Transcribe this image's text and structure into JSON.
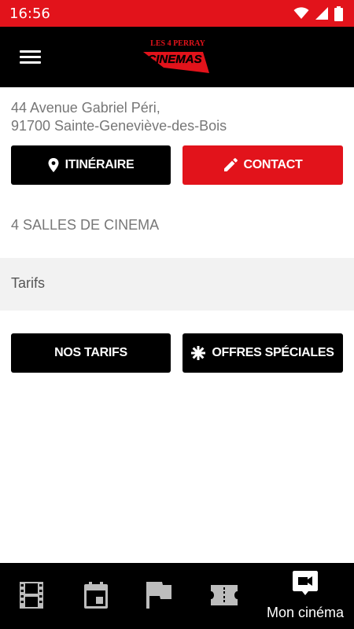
{
  "status_bar": {
    "time": "16:56",
    "icons": [
      "wifi-icon",
      "signal-icon",
      "battery-icon"
    ]
  },
  "app_bar": {
    "logo_top": "LES 4 PERRAY",
    "logo_main": "CINEMAS",
    "menu_icon": "hamburger-menu-icon"
  },
  "address": {
    "line1": "44 Avenue Gabriel Péri,",
    "line2": "91700 Sainte-Geneviève-des-Bois"
  },
  "actions": {
    "itinerary_label": "ITINÉRAIRE",
    "itinerary_icon": "location-pin-icon",
    "contact_label": "CONTACT",
    "contact_icon": "pencil-icon"
  },
  "salles_text": "4 SALLES DE CINEMA",
  "tarifs": {
    "title": "Tarifs",
    "nos_tarifs_label": "NOS TARIFS",
    "offres_label": "OFFRES SPÉCIALES",
    "offres_icon": "asterisk-icon"
  },
  "bottom_nav": {
    "items": [
      {
        "icon": "film-strip-icon",
        "label": ""
      },
      {
        "icon": "calendar-icon",
        "label": ""
      },
      {
        "icon": "flag-icon",
        "label": ""
      },
      {
        "icon": "ticket-icon",
        "label": ""
      },
      {
        "icon": "video-camera-icon",
        "label": "Mon cinéma",
        "active": true
      }
    ]
  },
  "colors": {
    "brand_red": "#e2131b",
    "black": "#000000",
    "text_gray": "#777777",
    "band_gray": "#f2f2f2",
    "inactive_icon": "#bdbdbd"
  }
}
